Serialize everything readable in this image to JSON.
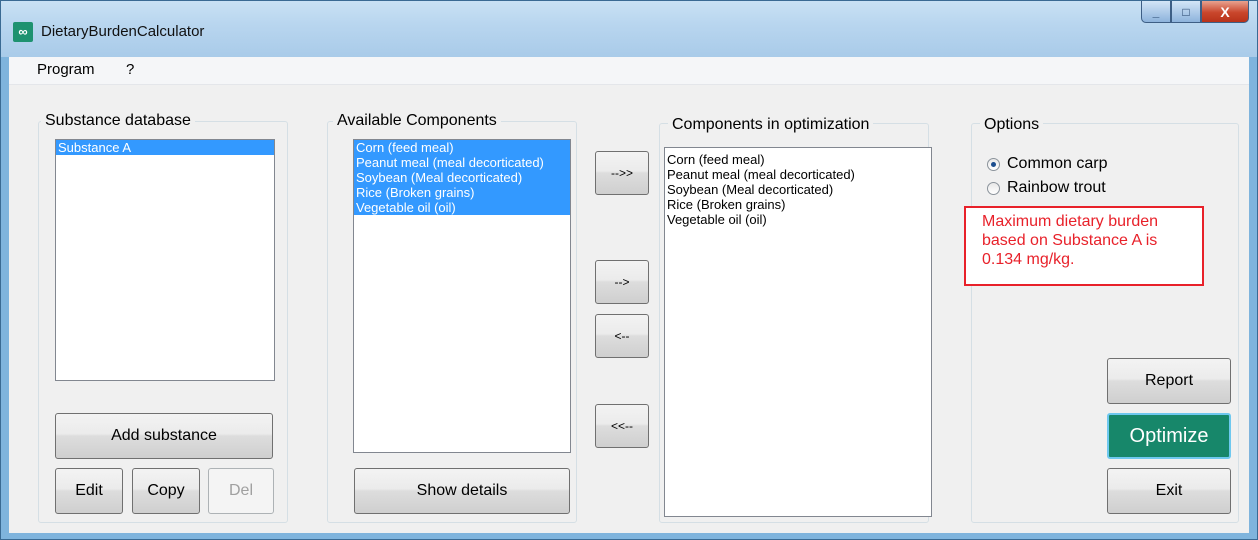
{
  "window": {
    "title": "DietaryBurdenCalculator",
    "icon": "app-logo-icon",
    "controls": {
      "minimize": "_",
      "maximize": "□",
      "close": "X"
    }
  },
  "menu": [
    "Program",
    "?"
  ],
  "substance_db": {
    "legend": "Substance database",
    "items": [
      {
        "label": "Substance A",
        "selected": true
      }
    ],
    "add_label": "Add substance",
    "edit_label": "Edit",
    "copy_label": "Copy",
    "del_label": "Del"
  },
  "available": {
    "legend": "Available Components",
    "items": [
      {
        "label": "Corn (feed meal)",
        "selected": true
      },
      {
        "label": "Peanut meal (meal decorticated)",
        "selected": true
      },
      {
        "label": "Soybean (Meal decorticated)",
        "selected": true
      },
      {
        "label": "Rice (Broken grains)",
        "selected": true
      },
      {
        "label": "Vegetable oil (oil)",
        "selected": true
      }
    ],
    "details_label": "Show details"
  },
  "transfer": {
    "add_all": "-->>",
    "add_one": "-->",
    "remove_one": "<--",
    "remove_all": "<<--"
  },
  "optimization": {
    "legend": "Components in optimization",
    "items": [
      {
        "label": "Corn (feed meal)"
      },
      {
        "label": "Peanut meal (meal decorticated)"
      },
      {
        "label": "Soybean (Meal decorticated)"
      },
      {
        "label": "Rice (Broken grains)"
      },
      {
        "label": "Vegetable oil (oil)"
      }
    ]
  },
  "options": {
    "legend": "Options",
    "radio1": "Common carp",
    "radio2": "Rainbow trout",
    "selected": "Common carp",
    "result": "Maximum dietary burden based on Substance A is 0.134 mg/kg.",
    "report_label": "Report",
    "optimize_label": "Optimize",
    "exit_label": "Exit"
  },
  "colors": {
    "selection": "#3399ff",
    "optimize_button": "#17876a",
    "result_text": "#e8212a"
  }
}
